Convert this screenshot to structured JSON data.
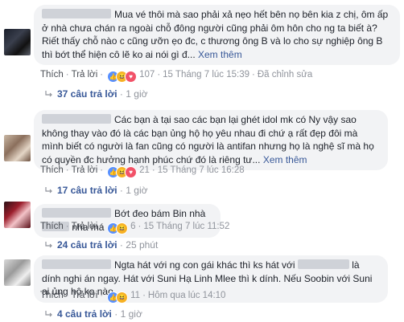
{
  "comments": [
    {
      "text": "Mua vé thôi mà sao phải xả nẹo hết bên nọ bên kia z chị, ôm ấp ở nhà chưa chán ra ngoài chỗ đông người cũng phải ôm hôn cho ng ta biết à? Riết thấy chỗ nào c cũng ưỡn ẹo đc, c thương ông B và lo cho sự nghiệp ông B thì bớt thể hiện cô lẽ ko ai nói gì đ...",
      "more": "Xem thêm",
      "like": "Thích",
      "reply": "Trả lời",
      "reactions": "107",
      "time": "15 Tháng 7 lúc 15:39",
      "edited": "Đã chỉnh sửa",
      "replies_label": "37 câu trả lời",
      "replies_time": "1 giờ"
    },
    {
      "text": "Các bạn à tại sao các bạn lại ghét idol mk có Ny vậy sao không thay vào đó là các bạn ủng hộ họ yêu nhau đi chứ ạ rất đẹp đôi mà mình biết có người là fan cũng có người là antifan nhưng họ là nghệ sĩ mà họ có quyền đc hưởng hạnh phúc chứ đó là riêng tư...",
      "more": "Xem thêm",
      "like": "Thích",
      "reply": "Trả lời",
      "reactions": "21",
      "time": "15 Tháng 7 lúc 16:28",
      "replies_label": "17 câu trả lời",
      "replies_time": "1 giờ"
    },
    {
      "text_before": "Bớt đeo bám Bin nhà",
      "text_after": "nha má",
      "like": "Thích",
      "reply": "Trả lời",
      "reactions": "6",
      "time": "15 Tháng 7 lúc 11:52",
      "replies_label": "24 câu trả lời",
      "replies_time": "25 phút"
    },
    {
      "text_before": "Ngta hát với ng con gái khác thì ks hát với",
      "text_after": "là dính nghi án ngay. Hát với Suni Hạ Linh Mlee thì k dính. Nếu Soobin với Suni ai ủng hộ ko nào",
      "like": "Thích",
      "reply": "Trả lời",
      "reactions": "11",
      "time": "Hôm qua lúc 14:10",
      "replies_label": "4 câu trả lời",
      "replies_time": "1 giờ"
    }
  ]
}
